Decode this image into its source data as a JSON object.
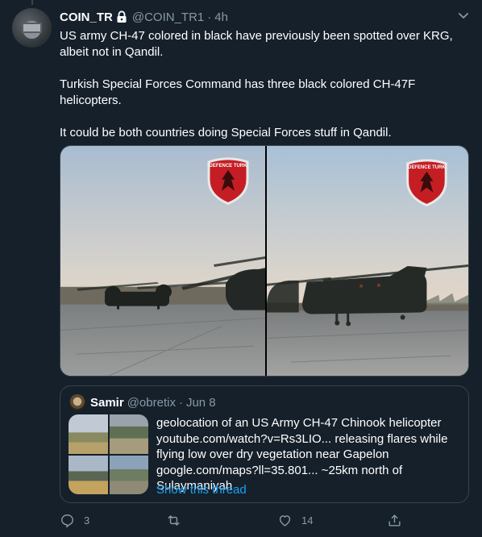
{
  "tweet": {
    "author_name": "COIN_TR",
    "author_handle": "@COIN_TR1",
    "separator": "·",
    "time": "4h",
    "paragraphs": [
      "US army CH-47 colored in black have previously been spotted over KRG, albeit not in Qandil.",
      "Turkish Special Forces Command has three black colored CH-47F helicopters.",
      "It could be both countries doing Special Forces stuff in Qandil."
    ],
    "media_watermark": "DEFENCE TURK"
  },
  "quote": {
    "author_name": "Samir",
    "author_handle": "@obretix",
    "separator": "·",
    "time": "Jun 8",
    "text": "geolocation of an US Army CH-47 Chinook helicopter youtube.com/watch?v=Rs3LIO... releasing flares while flying low over dry vegetation near Gapelon google.com/maps?ll=35.801... ~25km north of Sulaymaniyah",
    "show_thread": "Show this thread"
  },
  "actions": {
    "reply_count": "3",
    "retweet_count": "",
    "like_count": "14"
  },
  "icons": {
    "lock": "lock-icon",
    "caret": "chevron-down-icon",
    "reply": "reply-icon",
    "retweet": "retweet-icon",
    "like": "heart-icon",
    "share": "share-icon"
  },
  "colors": {
    "background": "#15202b",
    "secondary_text": "#8899a6",
    "link": "#1da1f2",
    "border": "#38444d"
  }
}
